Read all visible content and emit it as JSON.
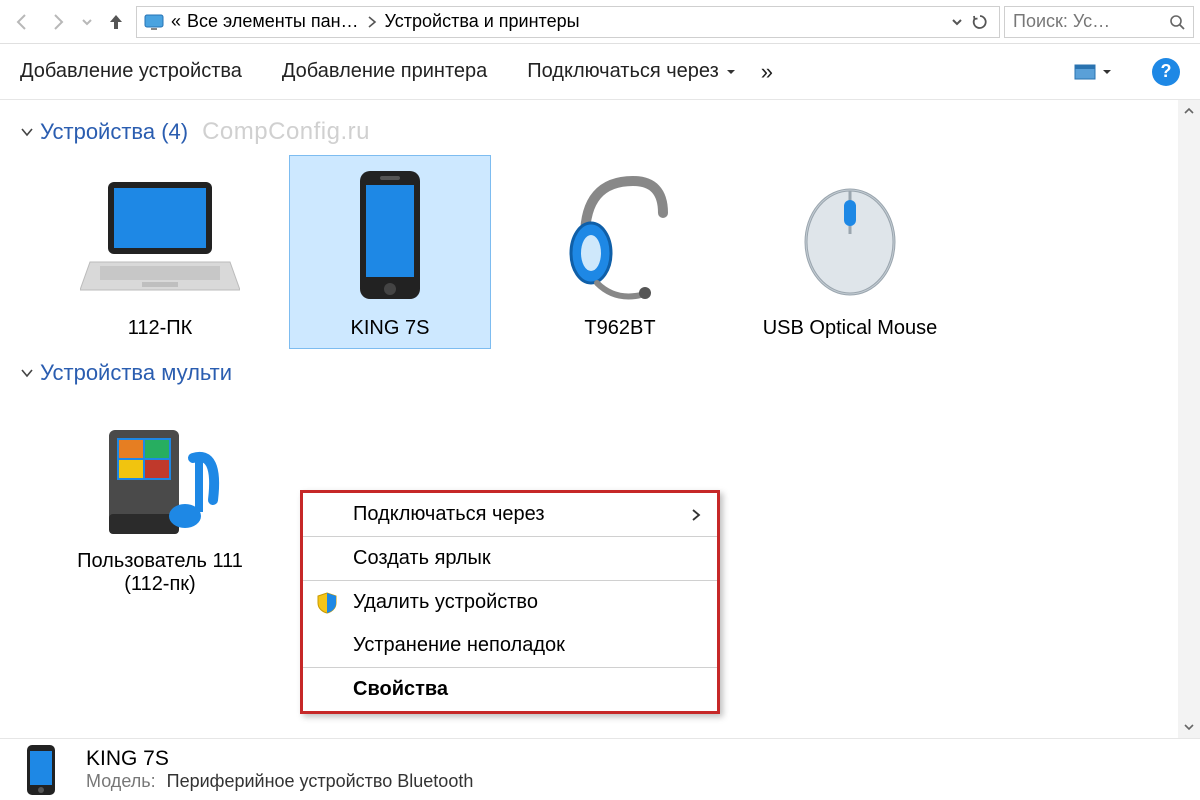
{
  "breadcrumbs": {
    "parent": "Все элементы пан…",
    "current": "Устройства и принтеры",
    "prefix": "«"
  },
  "search": {
    "placeholder": "Поиск: Ус…"
  },
  "toolbar": {
    "add_device": "Добавление устройства",
    "add_printer": "Добавление принтера",
    "connect_via": "Подключаться через",
    "overflow": "»",
    "help": "?"
  },
  "groups": {
    "devices": {
      "title": "Устройства (4)"
    },
    "multimedia": {
      "title": "Устройства мульти"
    }
  },
  "watermark": "CompConfig.ru",
  "devices": [
    {
      "label": "112-ПК"
    },
    {
      "label": "KING 7S"
    },
    {
      "label": "T962BT"
    },
    {
      "label": "USB Optical Mouse"
    }
  ],
  "multimedia_devices": [
    {
      "label": "Пользователь 111 (112-пк)"
    }
  ],
  "context_menu": {
    "connect_via": "Подключаться через",
    "create_shortcut": "Создать ярлык",
    "remove_device": "Удалить устройство",
    "troubleshoot": "Устранение неполадок",
    "properties": "Свойства"
  },
  "details": {
    "name": "KING 7S",
    "model_label": "Модель:",
    "model_value": "Периферийное устройство Bluetooth"
  }
}
